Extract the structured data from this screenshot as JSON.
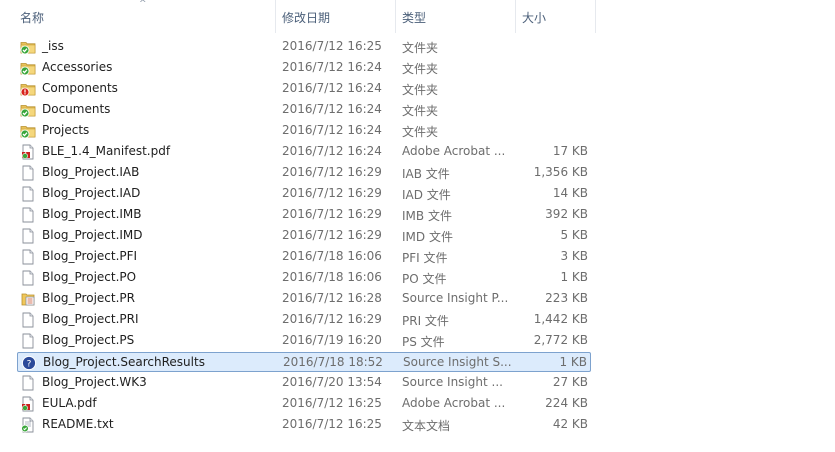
{
  "columns": [
    {
      "label": "名称"
    },
    {
      "label": "修改日期"
    },
    {
      "label": "类型"
    },
    {
      "label": "大小"
    }
  ],
  "files": [
    {
      "name": "_iss",
      "date": "2016/7/12 16:25",
      "type": "文件夹",
      "size": "",
      "icon": "folder-sync-ok-icon"
    },
    {
      "name": "Accessories",
      "date": "2016/7/12 16:24",
      "type": "文件夹",
      "size": "",
      "icon": "folder-sync-ok-icon"
    },
    {
      "name": "Components",
      "date": "2016/7/12 16:24",
      "type": "文件夹",
      "size": "",
      "icon": "folder-sync-error-icon"
    },
    {
      "name": "Documents",
      "date": "2016/7/12 16:24",
      "type": "文件夹",
      "size": "",
      "icon": "folder-sync-ok-icon"
    },
    {
      "name": "Projects",
      "date": "2016/7/12 16:24",
      "type": "文件夹",
      "size": "",
      "icon": "folder-sync-ok-icon"
    },
    {
      "name": "BLE_1.4_Manifest.pdf",
      "date": "2016/7/12 16:24",
      "type": "Adobe Acrobat ...",
      "size": "17 KB",
      "icon": "pdf-file-icon"
    },
    {
      "name": "Blog_Project.IAB",
      "date": "2016/7/12 16:29",
      "type": "IAB 文件",
      "size": "1,356 KB",
      "icon": "generic-file-icon"
    },
    {
      "name": "Blog_Project.IAD",
      "date": "2016/7/12 16:29",
      "type": "IAD 文件",
      "size": "14 KB",
      "icon": "generic-file-icon"
    },
    {
      "name": "Blog_Project.IMB",
      "date": "2016/7/12 16:29",
      "type": "IMB 文件",
      "size": "392 KB",
      "icon": "generic-file-icon"
    },
    {
      "name": "Blog_Project.IMD",
      "date": "2016/7/12 16:29",
      "type": "IMD 文件",
      "size": "5 KB",
      "icon": "generic-file-icon"
    },
    {
      "name": "Blog_Project.PFI",
      "date": "2016/7/18 16:06",
      "type": "PFI 文件",
      "size": "3 KB",
      "icon": "generic-file-icon"
    },
    {
      "name": "Blog_Project.PO",
      "date": "2016/7/18 16:06",
      "type": "PO 文件",
      "size": "1 KB",
      "icon": "generic-file-icon"
    },
    {
      "name": "Blog_Project.PR",
      "date": "2016/7/12 16:28",
      "type": "Source Insight P...",
      "size": "223 KB",
      "icon": "source-insight-project-icon"
    },
    {
      "name": "Blog_Project.PRI",
      "date": "2016/7/12 16:29",
      "type": "PRI 文件",
      "size": "1,442 KB",
      "icon": "generic-file-icon"
    },
    {
      "name": "Blog_Project.PS",
      "date": "2016/7/19 16:20",
      "type": "PS 文件",
      "size": "2,772 KB",
      "icon": "generic-file-icon"
    },
    {
      "name": "Blog_Project.SearchResults",
      "date": "2016/7/18 18:52",
      "type": "Source Insight S...",
      "size": "1 KB",
      "icon": "unknown-file-icon",
      "selected": true
    },
    {
      "name": "Blog_Project.WK3",
      "date": "2016/7/20 13:54",
      "type": "Source Insight ...",
      "size": "27 KB",
      "icon": "generic-file-icon"
    },
    {
      "name": "EULA.pdf",
      "date": "2016/7/12 16:25",
      "type": "Adobe Acrobat ...",
      "size": "224 KB",
      "icon": "pdf-file-icon"
    },
    {
      "name": "README.txt",
      "date": "2016/7/12 16:25",
      "type": "文本文档",
      "size": "42 KB",
      "icon": "text-file-sync-ok-icon"
    }
  ],
  "colors": {
    "header_text": "#4c607a",
    "selection_bg": "#dcebfc",
    "selection_border": "#7da2ce",
    "secondary_text": "#6d6d6d",
    "sync_ok_green": "#3aa63a",
    "sync_error_red": "#d8241c"
  }
}
